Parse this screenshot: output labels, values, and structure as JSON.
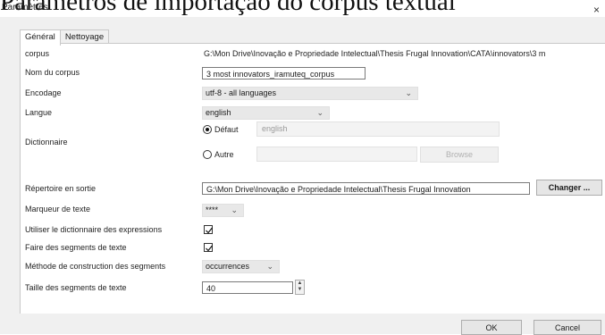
{
  "caption": "Parâmetros de importação do corpus textual",
  "dialog": {
    "title": "Paramètres",
    "close_glyph": "×"
  },
  "tabs": [
    {
      "label": "Général"
    },
    {
      "label": "Nettoyage"
    }
  ],
  "fields": {
    "corpus": {
      "label": "corpus",
      "value": "G:\\Mon Drive\\Inovação e Propriedade Intelectual\\Thesis Frugal Innovation\\CATA\\innovators\\3 m"
    },
    "nom_corpus": {
      "label": "Nom du corpus",
      "value": "3 most innovators_iramuteq_corpus"
    },
    "encodage": {
      "label": "Encodage",
      "value": "utf-8 - all languages"
    },
    "langue": {
      "label": "Langue",
      "value": "english"
    },
    "dictionnaire": {
      "label": "Dictionnaire",
      "defaut_label": "Défaut",
      "defaut_value": "english",
      "autre_label": "Autre",
      "autre_value": "",
      "browse_label": "Browse"
    },
    "repertoire": {
      "label": "Répertoire en sortie",
      "value": "G:\\Mon Drive\\Inovação e Propriedade Intelectual\\Thesis Frugal Innovation",
      "button": "Changer ..."
    },
    "marqueur": {
      "label": "Marqueur de texte",
      "value": "****"
    },
    "dict_expressions": {
      "label": "Utiliser le dictionnaire des expressions",
      "checked": true
    },
    "segments": {
      "label": "Faire des segments de texte",
      "checked": true
    },
    "methode": {
      "label": "Méthode de construction des segments",
      "value": "occurrences"
    },
    "taille": {
      "label": "Taille des segments de texte",
      "value": "40"
    }
  },
  "footer": {
    "ok": "OK",
    "cancel": "Cancel"
  },
  "icons": {
    "dropdown": "chevron-down-icon",
    "spin_up": "▲",
    "spin_down": "▼"
  }
}
